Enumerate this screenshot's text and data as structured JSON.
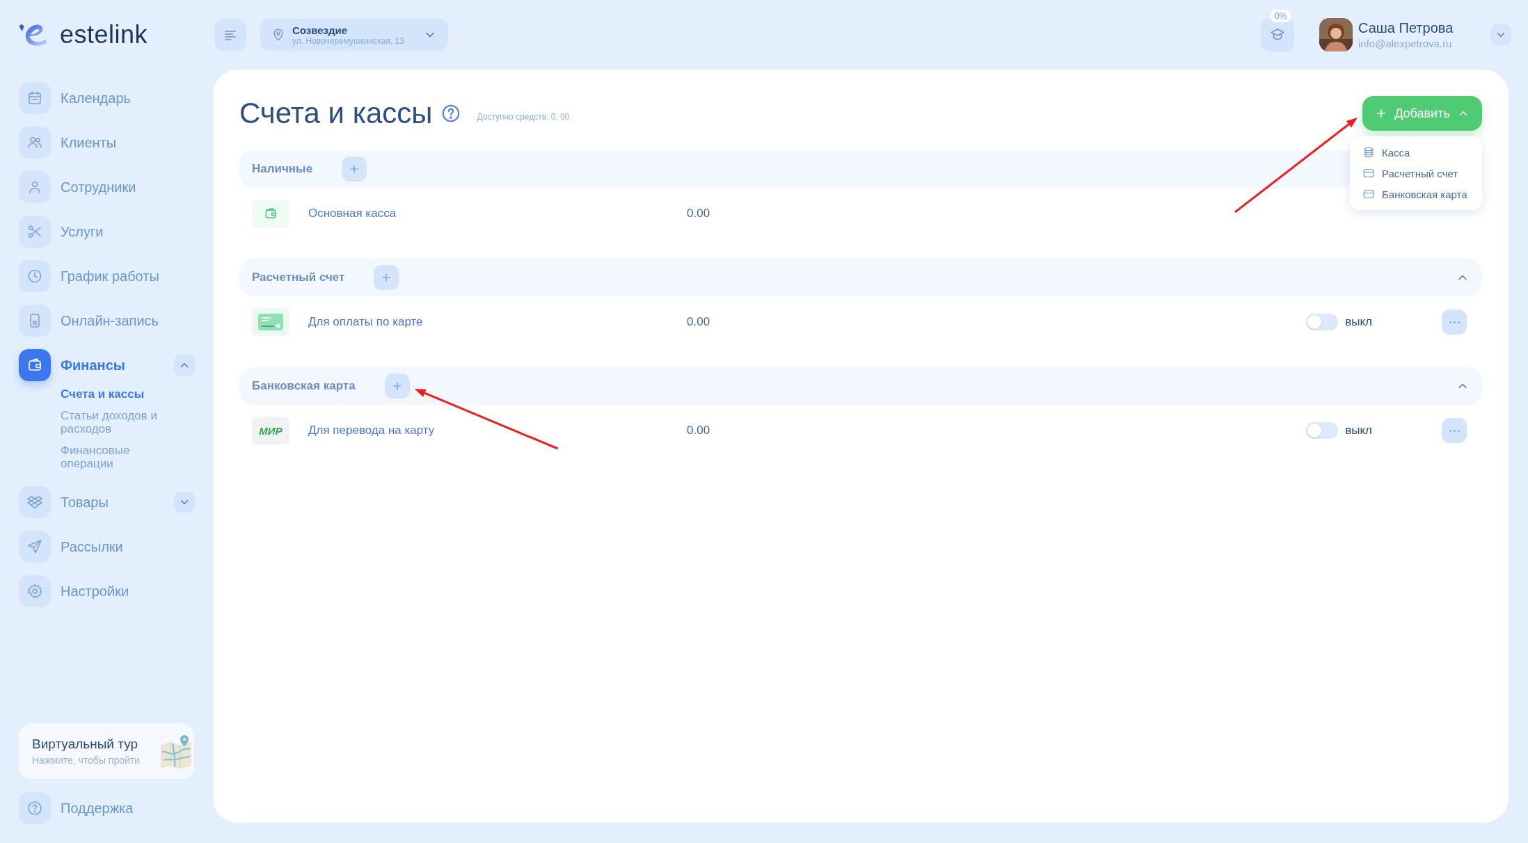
{
  "logo": {
    "text": "estelink"
  },
  "header": {
    "location": {
      "name": "Созвездие",
      "address": "ул. Новочеремушкинская, 13"
    },
    "progress_badge": "0%",
    "user": {
      "name": "Саша Петрова",
      "email": "info@alexpetrova.ru"
    }
  },
  "sidebar": {
    "items": [
      {
        "label": "Календарь",
        "selected": false
      },
      {
        "label": "Клиенты",
        "selected": false
      },
      {
        "label": "Сотрудники",
        "selected": false
      },
      {
        "label": "Услуги",
        "selected": false
      },
      {
        "label": "График работы",
        "selected": false
      },
      {
        "label": "Онлайн-запись",
        "selected": false
      },
      {
        "label": "Финансы",
        "selected": true,
        "expanded": true,
        "children": [
          {
            "label": "Счета и кассы",
            "selected": true
          },
          {
            "label": "Статьи доходов и расходов",
            "selected": false
          },
          {
            "label": "Финансовые операции",
            "selected": false
          }
        ]
      },
      {
        "label": "Товары",
        "selected": false,
        "expanded": false
      },
      {
        "label": "Рассылки",
        "selected": false
      },
      {
        "label": "Настройки",
        "selected": false
      }
    ],
    "tour": {
      "title": "Виртуальный тур",
      "subtitle": "Нажмите, чтобы пройти"
    },
    "support": {
      "label": "Поддержка"
    }
  },
  "page": {
    "title": "Счета и кассы",
    "available": "Доступно средств: 0. 00",
    "add_button": {
      "label": "Добавить",
      "expanded": true
    },
    "add_menu": [
      {
        "label": "Касса"
      },
      {
        "label": "Расчетный счет"
      },
      {
        "label": "Банковская карта"
      }
    ],
    "sections": [
      {
        "title": "Наличные",
        "rows": [
          {
            "kind": "cash",
            "name": "Основная касса",
            "amount": "0.00"
          }
        ]
      },
      {
        "title": "Расчетный счет",
        "expanded": true,
        "rows": [
          {
            "kind": "card",
            "name": "Для оплаты по карте",
            "amount": "0.00",
            "toggle": {
              "on": false,
              "label": "выкл"
            }
          }
        ]
      },
      {
        "title": "Банковская карта",
        "expanded": true,
        "rows": [
          {
            "kind": "mir",
            "name": "Для перевода на карту",
            "amount": "0.00",
            "logo_text": "МИР",
            "toggle": {
              "on": false,
              "label": "выкл"
            }
          }
        ]
      }
    ]
  }
}
